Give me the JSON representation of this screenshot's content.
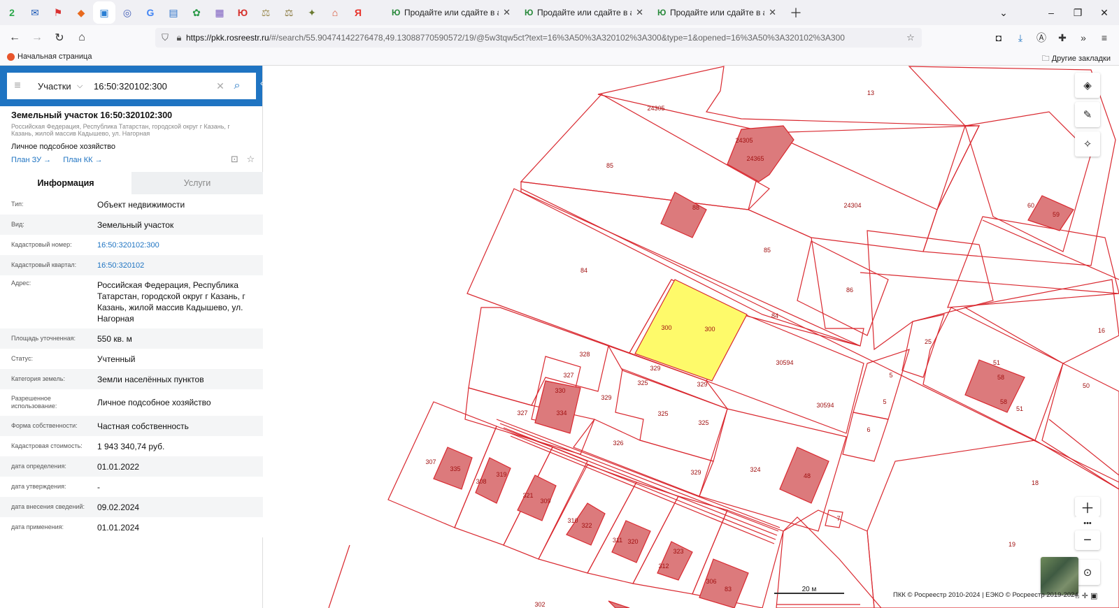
{
  "browser": {
    "pinned": [
      {
        "icon": "green-circle-icon",
        "glyph": "2",
        "color": "#2ba84a"
      },
      {
        "icon": "mail-icon",
        "glyph": "✉",
        "color": "#1e5bb8"
      },
      {
        "icon": "flag-icon",
        "glyph": "⚑",
        "color": "#d93030"
      },
      {
        "icon": "badge-icon",
        "glyph": "◆",
        "color": "#e86a1e"
      },
      {
        "icon": "map-icon",
        "glyph": "▣",
        "color": "#2a7fd4"
      },
      {
        "icon": "target-icon",
        "glyph": "◎",
        "color": "#4460b8"
      },
      {
        "icon": "google-icon",
        "glyph": "G",
        "color": "#4285f4"
      },
      {
        "icon": "gosuslugi-icon",
        "glyph": "▤",
        "color": "#2c72c9"
      },
      {
        "icon": "leaf-icon",
        "glyph": "✿",
        "color": "#2a9a48"
      },
      {
        "icon": "grid-icon",
        "glyph": "▦",
        "color": "#7a5bbf"
      },
      {
        "icon": "logo-icon",
        "glyph": "Ю",
        "color": "#d6302b"
      },
      {
        "icon": "scales-icon",
        "glyph": "⚖",
        "color": "#9a8a50"
      },
      {
        "icon": "scales-icon",
        "glyph": "⚖",
        "color": "#8a7a40"
      },
      {
        "icon": "emblem-icon",
        "glyph": "✦",
        "color": "#6a7a30"
      },
      {
        "icon": "house-icon",
        "glyph": "⌂",
        "color": "#d64a2a"
      },
      {
        "icon": "yandex-icon",
        "glyph": "Я",
        "color": "#e8322a"
      }
    ],
    "tabs": [
      {
        "title": "Продайте или сдайте в аренду"
      },
      {
        "title": "Продайте или сдайте в аренду"
      },
      {
        "title": "Продайте или сдайте в аренду"
      }
    ],
    "url_host": "https://pkk.rosreestr.ru",
    "url_rest": "/#/search/55.90474142276478,49.13088770590572/19/@5w3tqw5ct?text=16%3A50%3A320102%3A300&type=1&opened=16%3A50%3A320102%3A300",
    "bookmark_home": "Начальная страница",
    "bookmark_other": "Другие закладки"
  },
  "search": {
    "type_label": "Участки",
    "query": "16:50:320102:300"
  },
  "object": {
    "title": "Земельный участок 16:50:320102:300",
    "address_short": "Российская Федерация, Республика Татарстан, городской округ г Казань, г Казань, жилой массив Кадышево, ул. Нагорная",
    "use": "Личное подсобное хозяйство",
    "plan_zu": "План ЗУ →",
    "plan_kk": "План КК →"
  },
  "info_tabs": {
    "info": "Информация",
    "services": "Услуги"
  },
  "rows": [
    {
      "label": "Тип:",
      "value": "Объект недвижимости"
    },
    {
      "label": "Вид:",
      "value": "Земельный участок"
    },
    {
      "label": "Кадастровый номер:",
      "value": "16:50:320102:300",
      "link": true
    },
    {
      "label": "Кадастровый квартал:",
      "value": "16:50:320102",
      "link": true
    },
    {
      "label": "Адрес:",
      "value": "Российская Федерация, Республика Татарстан, городской округ г Казань, г Казань, жилой массив Кадышево, ул. Нагорная",
      "tall": true
    },
    {
      "label": "Площадь уточненная:",
      "value": "550 кв. м"
    },
    {
      "label": "Статус:",
      "value": "Учтенный"
    },
    {
      "label": "Категория земель:",
      "value": "Земли населённых пунктов"
    },
    {
      "label": "Разрешенное использование:",
      "value": "Личное подсобное хозяйство",
      "tall2": true
    },
    {
      "label": "Форма собственности:",
      "value": "Частная собственность"
    },
    {
      "label": "Кадастровая стоимость:",
      "value": "1 943 340,74 руб."
    },
    {
      "label": "дата определения:",
      "value": "01.01.2022"
    },
    {
      "label": "дата утверждения:",
      "value": "-"
    },
    {
      "label": "дата внесения сведений:",
      "value": "09.02.2024"
    },
    {
      "label": "дата применения:",
      "value": "01.01.2024"
    }
  ],
  "map": {
    "parcel_labels": [
      "13",
      "24305",
      "24305",
      "24365",
      "85",
      "24304",
      "60",
      "59",
      "88",
      "85",
      "84",
      "300",
      "300",
      "84",
      "86",
      "16",
      "25",
      "51",
      "58",
      "58",
      "328",
      "327",
      "330",
      "329",
      "325",
      "329",
      "30594",
      "5",
      "50",
      "329",
      "325",
      "325",
      "30594",
      "5",
      "51",
      "6",
      "327",
      "334",
      "326",
      "329",
      "307",
      "335",
      "308",
      "319",
      "324",
      "48",
      "18",
      "309",
      "321",
      "7",
      "310",
      "322",
      "311",
      "320",
      "312",
      "323",
      "19",
      "306",
      "83",
      "302"
    ],
    "scale_label": "20 м",
    "copyright": "ПКК © Росреестр 2010-2024 | ЕЭКО © Росреестр 2019-2024",
    "colors": {
      "parcel": "#d9282f",
      "building": "#dc7a7c",
      "selected": "#fefa6a"
    }
  }
}
